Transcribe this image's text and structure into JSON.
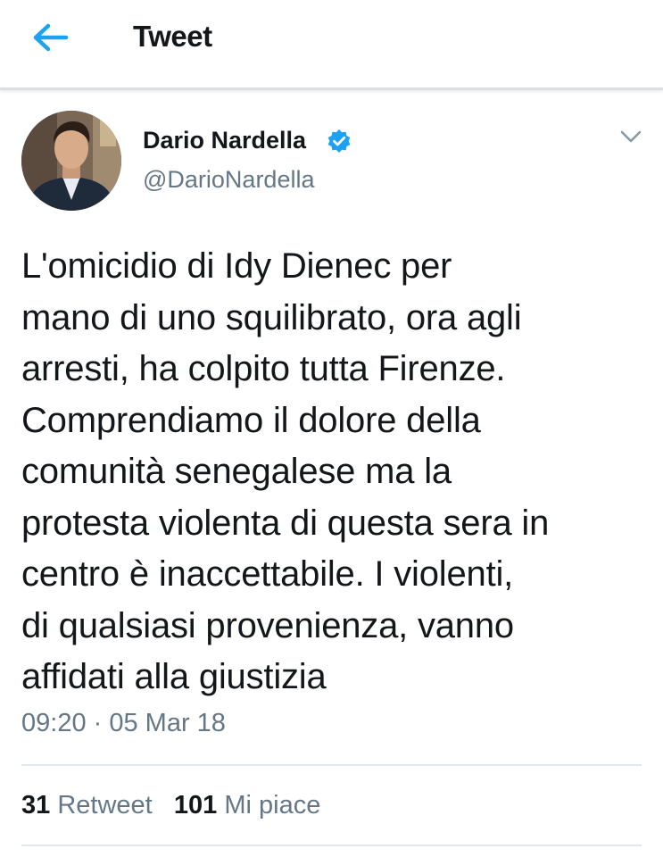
{
  "header": {
    "title": "Tweet",
    "back_icon": "arrow-left-icon",
    "accent": "#1da1f2"
  },
  "tweet": {
    "author_name": "Dario Nardella",
    "verified": true,
    "handle": "@DarioNardella",
    "text_lines": [
      "L'omicidio di Idy Dienec per",
      "mano di uno squilibrato, ora agli",
      "arresti, ha colpito tutta Firenze.",
      "Comprendiamo il dolore della",
      "comunità senegalese ma la",
      "protesta violenta di questa sera in",
      "centro è inaccettabile. I violenti,",
      "di qualsiasi provenienza, vanno",
      "affidati alla giustizia"
    ],
    "timestamp": "09:20 · 05 Mar 18"
  },
  "stats": {
    "retweet_count": "31",
    "retweet_label": "Retweet",
    "like_count": "101",
    "like_label": "Mi piace"
  },
  "colors": {
    "secondary_text": "#657786",
    "verified_blue": "#1da1f2",
    "divider": "#e1e8ed"
  }
}
